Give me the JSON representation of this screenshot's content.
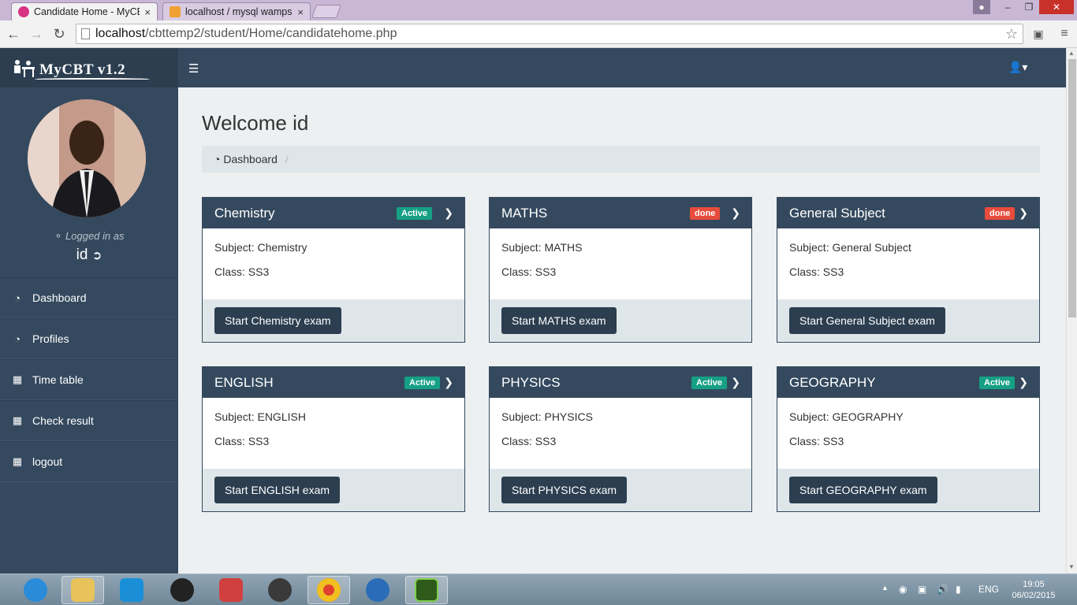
{
  "browser": {
    "tabs": [
      {
        "title": "Candidate Home - MyCBT",
        "close": "×"
      },
      {
        "title": "localhost / mysql wampse",
        "close": "×"
      }
    ],
    "url_host": "localhost",
    "url_path": "/cbttemp2/student/Home/candidatehome.php"
  },
  "app": {
    "brand": "MyCBT   v1.2",
    "logged_in_label": "Logged in as",
    "username": "id",
    "nav": [
      {
        "label": "Dashboard",
        "icon": "dashboard-icon"
      },
      {
        "label": "Profiles",
        "icon": "dashboard-icon"
      },
      {
        "label": "Time table",
        "icon": "calendar-icon"
      },
      {
        "label": "Check result",
        "icon": "calendar-icon"
      },
      {
        "label": "logout",
        "icon": "calendar-icon"
      }
    ]
  },
  "main": {
    "welcome": "Welcome id",
    "breadcrumb": "Dashboard",
    "breadcrumb_sep": "/",
    "cards": [
      {
        "title": "Chemistry",
        "status": "Active",
        "subject": "Subject: Chemistry",
        "class": "Class: SS3",
        "button": "Start Chemistry exam"
      },
      {
        "title": "MATHS",
        "status": "done",
        "subject": "Subject: MATHS",
        "class": "Class: SS3",
        "button": "Start MATHS exam"
      },
      {
        "title": "General Subject",
        "status": "done",
        "subject": "Subject: General Subject",
        "class": "Class: SS3",
        "button": "Start General Subject exam"
      },
      {
        "title": "ENGLISH",
        "status": "Active",
        "subject": "Subject: ENGLISH",
        "class": "Class: SS3",
        "button": "Start ENGLISH exam"
      },
      {
        "title": "PHYSICS",
        "status": "Active",
        "subject": "Subject: PHYSICS",
        "class": "Class: SS3",
        "button": "Start PHYSICS exam"
      },
      {
        "title": "GEOGRAPHY",
        "status": "Active",
        "subject": "Subject: GEOGRAPHY",
        "class": "Class: SS3",
        "button": "Start GEOGRAPHY exam"
      }
    ]
  },
  "taskbar": {
    "lang": "ENG",
    "time": "19:05",
    "date": "06/02/2015"
  },
  "colors": {
    "header": "#34495e",
    "active_badge": "#16a085",
    "done_badge": "#e74c3c"
  }
}
